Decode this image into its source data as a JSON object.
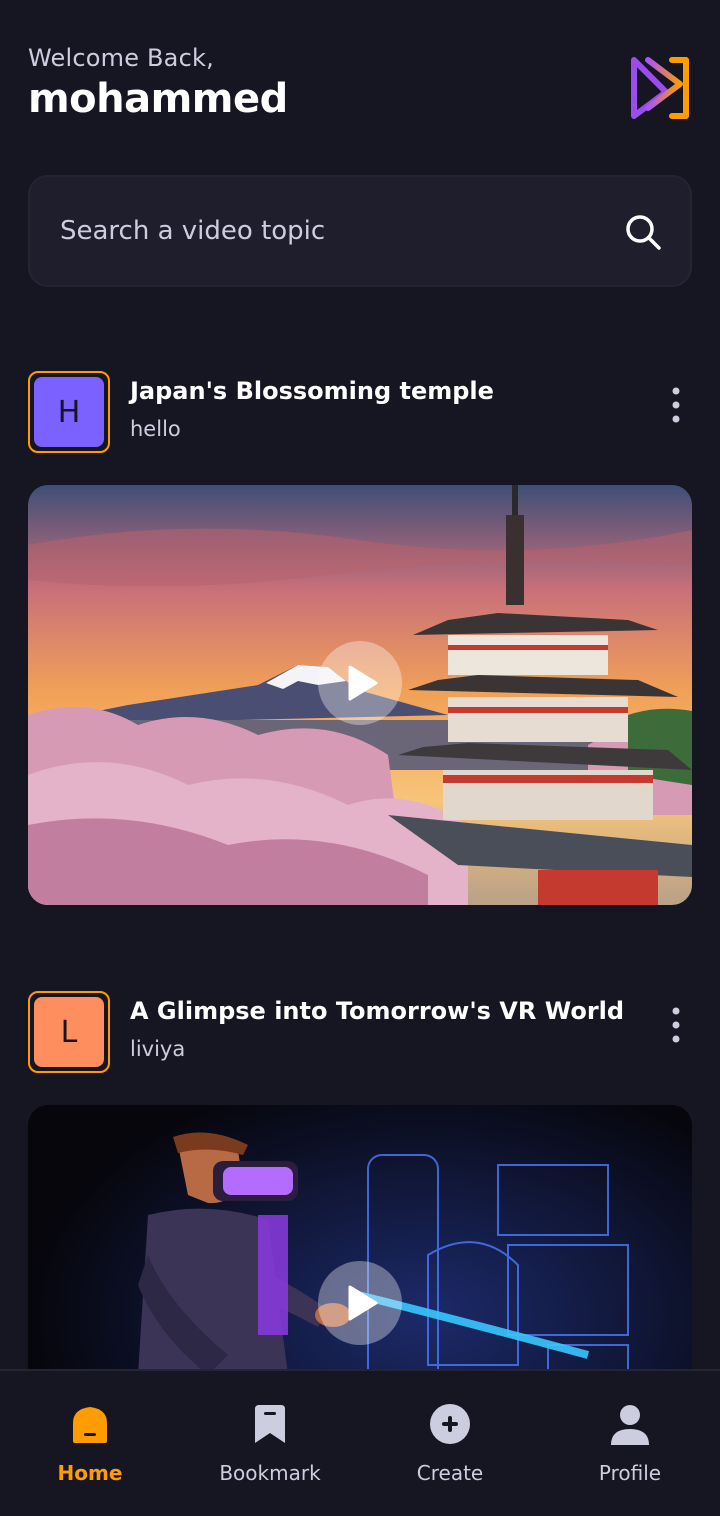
{
  "header": {
    "welcome": "Welcome Back,",
    "username": "mohammed"
  },
  "search": {
    "placeholder": "Search a video topic"
  },
  "posts": [
    {
      "initial": "H",
      "title": "Japan's Blossoming temple",
      "author": "hello",
      "avatar_color": "#7B61FF"
    },
    {
      "initial": "L",
      "title": "A Glimpse into Tomorrow's VR World",
      "author": "liviya",
      "avatar_color": "#FF8E5E"
    }
  ],
  "tabs": [
    {
      "label": "Home",
      "icon": "home-icon",
      "active": true
    },
    {
      "label": "Bookmark",
      "icon": "bookmark-icon",
      "active": false
    },
    {
      "label": "Create",
      "icon": "plus-circle-icon",
      "active": false
    },
    {
      "label": "Profile",
      "icon": "profile-icon",
      "active": false
    }
  ],
  "colors": {
    "background": "#161622",
    "accent": "#FF9C01",
    "muted_text": "#CDCDE0",
    "surface": "#1E1E2D"
  }
}
